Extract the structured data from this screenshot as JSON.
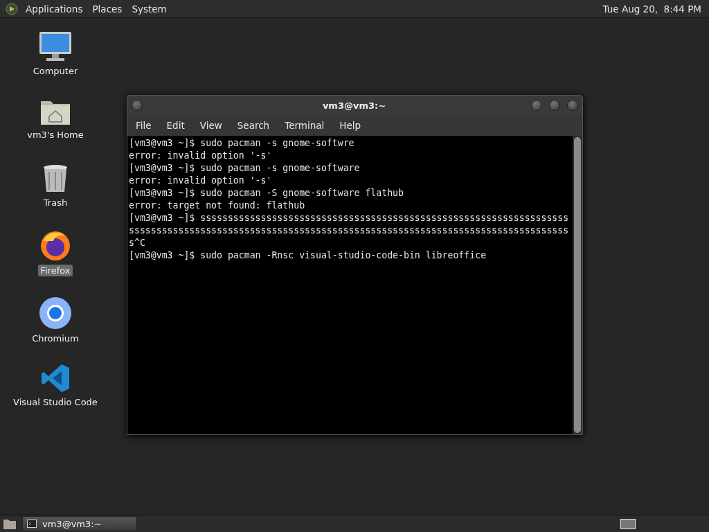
{
  "top_panel": {
    "menus": [
      "Applications",
      "Places",
      "System"
    ],
    "clock": "Tue Aug 20,  8:44 PM"
  },
  "desktop_icons": [
    {
      "kind": "computer",
      "label": "Computer",
      "selected": false
    },
    {
      "kind": "home",
      "label": "vm3's Home",
      "selected": false
    },
    {
      "kind": "trash",
      "label": "Trash",
      "selected": false
    },
    {
      "kind": "firefox",
      "label": "Firefox",
      "selected": true
    },
    {
      "kind": "chromium",
      "label": "Chromium",
      "selected": false
    },
    {
      "kind": "vscode",
      "label": "Visual Studio Code",
      "selected": false
    }
  ],
  "terminal": {
    "title": "vm3@vm3:~",
    "menu": [
      "File",
      "Edit",
      "View",
      "Search",
      "Terminal",
      "Help"
    ],
    "lines": [
      "[vm3@vm3 ~]$ sudo pacman -s gnome-softwre",
      "error: invalid option '-s'",
      "[vm3@vm3 ~]$ sudo pacman -s gnome-software",
      "error: invalid option '-s'",
      "[vm3@vm3 ~]$ sudo pacman -S gnome-software flathub",
      "error: target not found: flathub",
      "[vm3@vm3 ~]$ sssssssssssssssssssssssssssssssssssssssssssssssssssssssssssssssssss",
      "ssssssssssssssssssssssssssssssssssssssssssssssssssssssssssssssssssssssssssssssss",
      "s^C",
      "[vm3@vm3 ~]$ sudo pacman -Rnsc visual-studio-code-bin libreoffice"
    ]
  },
  "taskbar": {
    "tasks": [
      "vm3@vm3:~"
    ]
  }
}
